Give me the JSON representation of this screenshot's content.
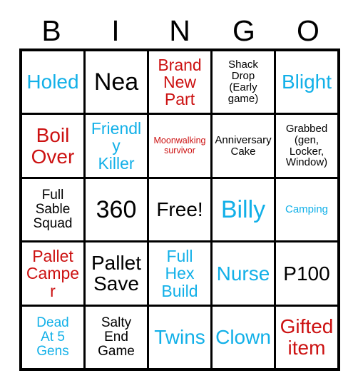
{
  "card": {
    "header_letters": [
      "B",
      "I",
      "N",
      "G",
      "O"
    ],
    "colors": {
      "black": "#000000",
      "blue": "#12b0e8",
      "red": "#cc1111",
      "grid_line": "#000000",
      "cell_background": "#ffffff"
    },
    "rows": [
      [
        {
          "text": "Holed",
          "color": "blue",
          "size": "lg"
        },
        {
          "text": "Nea",
          "color": "black",
          "size": "xl"
        },
        {
          "text": "Brand\nNew\nPart",
          "color": "red",
          "size": "md"
        },
        {
          "text": "Shack\nDrop\n(Early\ngame)",
          "color": "black",
          "size": "xs"
        },
        {
          "text": "Blight",
          "color": "blue",
          "size": "lg"
        }
      ],
      [
        {
          "text": "Boil\nOver",
          "color": "red",
          "size": "lg"
        },
        {
          "text": "Friendly\nKiller",
          "color": "blue",
          "size": "md"
        },
        {
          "text": "Moonwalking\nsurvivor",
          "color": "red",
          "size": "xxs"
        },
        {
          "text": "Anniversary\nCake",
          "color": "black",
          "size": "xs"
        },
        {
          "text": "Grabbed\n(gen,\nLocker,\nWindow)",
          "color": "black",
          "size": "xs"
        }
      ],
      [
        {
          "text": "Full\nSable\nSquad",
          "color": "black",
          "size": "sm"
        },
        {
          "text": "360",
          "color": "black",
          "size": "xl"
        },
        {
          "text": "Free!",
          "color": "black",
          "size": "lg"
        },
        {
          "text": "Billy",
          "color": "blue",
          "size": "xl"
        },
        {
          "text": "Camping",
          "color": "blue",
          "size": "xs"
        }
      ],
      [
        {
          "text": "Pallet\nCamper",
          "color": "red",
          "size": "md"
        },
        {
          "text": "Pallet\nSave",
          "color": "black",
          "size": "lg"
        },
        {
          "text": "Full\nHex\nBuild",
          "color": "blue",
          "size": "md"
        },
        {
          "text": "Nurse",
          "color": "blue",
          "size": "lg"
        },
        {
          "text": "P100",
          "color": "black",
          "size": "lg"
        }
      ],
      [
        {
          "text": "Dead\nAt 5\nGens",
          "color": "blue",
          "size": "sm"
        },
        {
          "text": "Salty\nEnd\nGame",
          "color": "black",
          "size": "sm"
        },
        {
          "text": "Twins",
          "color": "blue",
          "size": "lg"
        },
        {
          "text": "Clown",
          "color": "blue",
          "size": "lg"
        },
        {
          "text": "Gifted\nitem",
          "color": "red",
          "size": "lg"
        }
      ]
    ]
  }
}
